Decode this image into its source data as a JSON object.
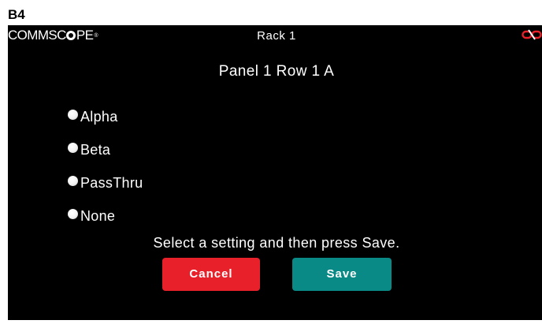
{
  "page_label": "B4",
  "header": {
    "logo_text_left": "COMMSC",
    "logo_text_right": "PE",
    "logo_tm": "®",
    "title": "Rack 1",
    "disconnect_icon": "broken-link-icon",
    "disconnect_icon_color": "#e8202a"
  },
  "panel_heading": "Panel 1 Row 1 A",
  "options": [
    {
      "label": "Alpha",
      "selected": false
    },
    {
      "label": "Beta",
      "selected": false
    },
    {
      "label": "PassThru",
      "selected": false
    },
    {
      "label": "None",
      "selected": false
    }
  ],
  "instruction": "Select a setting and then press Save.",
  "buttons": {
    "cancel_label": "Cancel",
    "cancel_color": "#e8202a",
    "save_label": "Save",
    "save_color": "#0a8a86"
  }
}
